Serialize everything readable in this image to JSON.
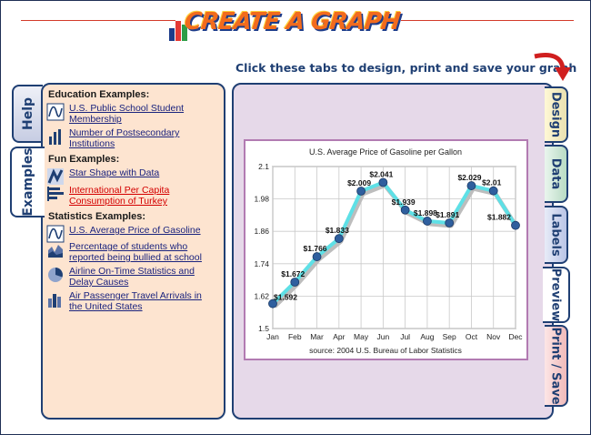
{
  "header": {
    "logo_text": "CREATE A GRAPH",
    "hint": "Click these tabs to design, print and save your graph"
  },
  "left_tabs": {
    "help": "Help",
    "examples": "Examples"
  },
  "right_tabs": {
    "design": "Design",
    "data": "Data",
    "labels": "Labels",
    "preview": "Preview",
    "print_save": "Print / Save"
  },
  "examples": {
    "education_title": "Education Examples:",
    "education": [
      {
        "label": "U.S. Public School Student Membership",
        "line1": "U.S. Public School Student",
        "line2": "Membership",
        "icon": "line-graph-icon"
      },
      {
        "label": "Number of Postsecondary Institutions",
        "line1": "Number of Postsecondary",
        "line2": "Institutions",
        "icon": "bar-graph-icon"
      }
    ],
    "fun_title": "Fun Examples:",
    "fun": [
      {
        "label": "Star Shape with Data",
        "line1": "Star Shape with Data",
        "line2": "",
        "icon": "xy-graph-icon"
      },
      {
        "label": "International Per Capita Consumption of Turkey",
        "line1": "International Per Capita",
        "line2": "Consumption of Turkey",
        "icon": "horizontal-bar-icon",
        "active": true
      }
    ],
    "stats_title": "Statistics Examples:",
    "stats": [
      {
        "label": "U.S. Average Price of Gasoline",
        "line1": "U.S. Average Price of Gasoline",
        "line2": "",
        "icon": "line-graph-icon"
      },
      {
        "label": "Percentage of students who reported being bullied at school",
        "line1": "Percentage of students who",
        "line2": "reported being bullied at school",
        "icon": "area-graph-icon"
      },
      {
        "label": "Airline On-Time Statistics and Delay Causes",
        "line1": "Airline On-Time Statistics and",
        "line2": "Delay Causes",
        "icon": "pie-chart-icon"
      },
      {
        "label": "Air Passenger Travel Arrivals in the United States",
        "line1": "Air Passenger Travel Arrivals in",
        "line2": "the United States",
        "icon": "bar-graph-icon"
      }
    ]
  },
  "colors": {
    "accent": "#1f3f73",
    "line": "#5ee0e6",
    "point": "#2f5f9e",
    "panel": "#fde4d0",
    "preview_bg": "#e6d9e9"
  },
  "chart_data": {
    "type": "line",
    "title": "U.S. Average Price of Gasoline per Gallon",
    "source": "source: 2004 U.S. Bureau of Labor Statistics",
    "categories": [
      "Jan",
      "Feb",
      "Mar",
      "Apr",
      "May",
      "Jun",
      "Jul",
      "Aug",
      "Sep",
      "Oct",
      "Nov",
      "Dec"
    ],
    "values": [
      1.592,
      1.672,
      1.766,
      1.833,
      2.009,
      2.041,
      1.939,
      1.898,
      1.891,
      2.029,
      2.01,
      1.882
    ],
    "labels": [
      "$1.592",
      "$1.672",
      "$1.766",
      "$1.833",
      "$2.009",
      "$2.041",
      "$1.939",
      "$1.898",
      "$1.891",
      "$2.029",
      "$2.01",
      "$1.882"
    ],
    "yticks": [
      "1.5",
      "1.62",
      "1.74",
      "1.86",
      "1.98",
      "2.1"
    ],
    "ylim": [
      1.5,
      2.1
    ],
    "grid": true
  }
}
